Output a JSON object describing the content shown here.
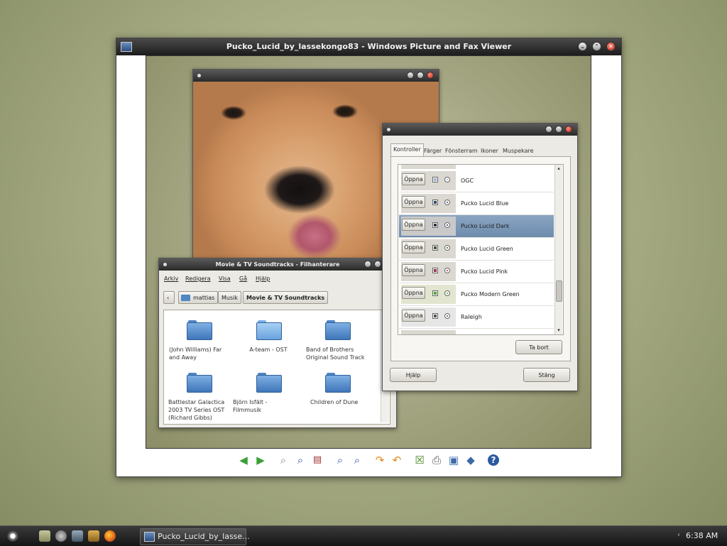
{
  "viewer": {
    "title": "Pucko_Lucid_by_lassekongo83 - Windows Picture and Fax Viewer",
    "controls": [
      "minimize",
      "maximize",
      "close"
    ],
    "toolbar": [
      "previous-image-icon",
      "next-image-icon",
      "best-fit-icon",
      "actual-size-icon",
      "slideshow-icon",
      "zoom-in-icon",
      "zoom-out-icon",
      "rotate-clockwise-icon",
      "rotate-counterclockwise-icon",
      "delete-icon",
      "print-icon",
      "save-icon",
      "open-editor-icon",
      "help-icon"
    ]
  },
  "file_manager": {
    "title": "Movie & TV Soundtracks - Filhanterare",
    "menu": [
      "Arkiv",
      "Redigera",
      "Visa",
      "Gå",
      "Hjälp"
    ],
    "breadcrumb": [
      "mattias",
      "Musik",
      "Movie & TV Soundtracks"
    ],
    "folders": [
      {
        "label": "(John Williams) Far and Away"
      },
      {
        "label": "A-team - OST"
      },
      {
        "label": "Band of Brothers Original Sound Track"
      },
      {
        "label": "Battlestar Galactica 2003 TV Series OST (Richard Gibbs)"
      },
      {
        "label": "Björn Isfält - Filmmusik"
      },
      {
        "label": "Children of Dune"
      }
    ]
  },
  "theme_dialog": {
    "tabs": [
      "Kontroller",
      "Färger",
      "Fönsterram",
      "Ikoner",
      "Muspekare"
    ],
    "active_tab": "Kontroller",
    "themes": [
      {
        "open_label": "Öppna",
        "name": "OGC",
        "color": "#9fb3d6"
      },
      {
        "open_label": "Öppna",
        "name": "Pucko Lucid Blue",
        "color": "#2f4a6a"
      },
      {
        "open_label": "Öppna",
        "name": "Pucko Lucid Dark",
        "color": "#2b3440"
      },
      {
        "open_label": "Öppna",
        "name": "Pucko Lucid Green",
        "color": "#3f5a2f"
      },
      {
        "open_label": "Öppna",
        "name": "Pucko Lucid Pink",
        "color": "#a03050"
      },
      {
        "open_label": "Öppna",
        "name": "Pucko Modern Green",
        "color": "#4da832"
      },
      {
        "open_label": "Öppna",
        "name": "Raleigh",
        "color": "#555555"
      }
    ],
    "selected_theme": "Pucko Lucid Dark",
    "remove_label": "Ta bort",
    "help_label": "Hjälp",
    "close_label": "Stäng"
  },
  "taskbar": {
    "window_title": "Pucko_Lucid_by_lasse...",
    "clock": "6:38 AM",
    "tray_left_icons": [
      "start-orb-icon",
      "file-manager-icon",
      "lock-icon",
      "settings-icon",
      "terminal-icon",
      "firefox-icon"
    ]
  }
}
